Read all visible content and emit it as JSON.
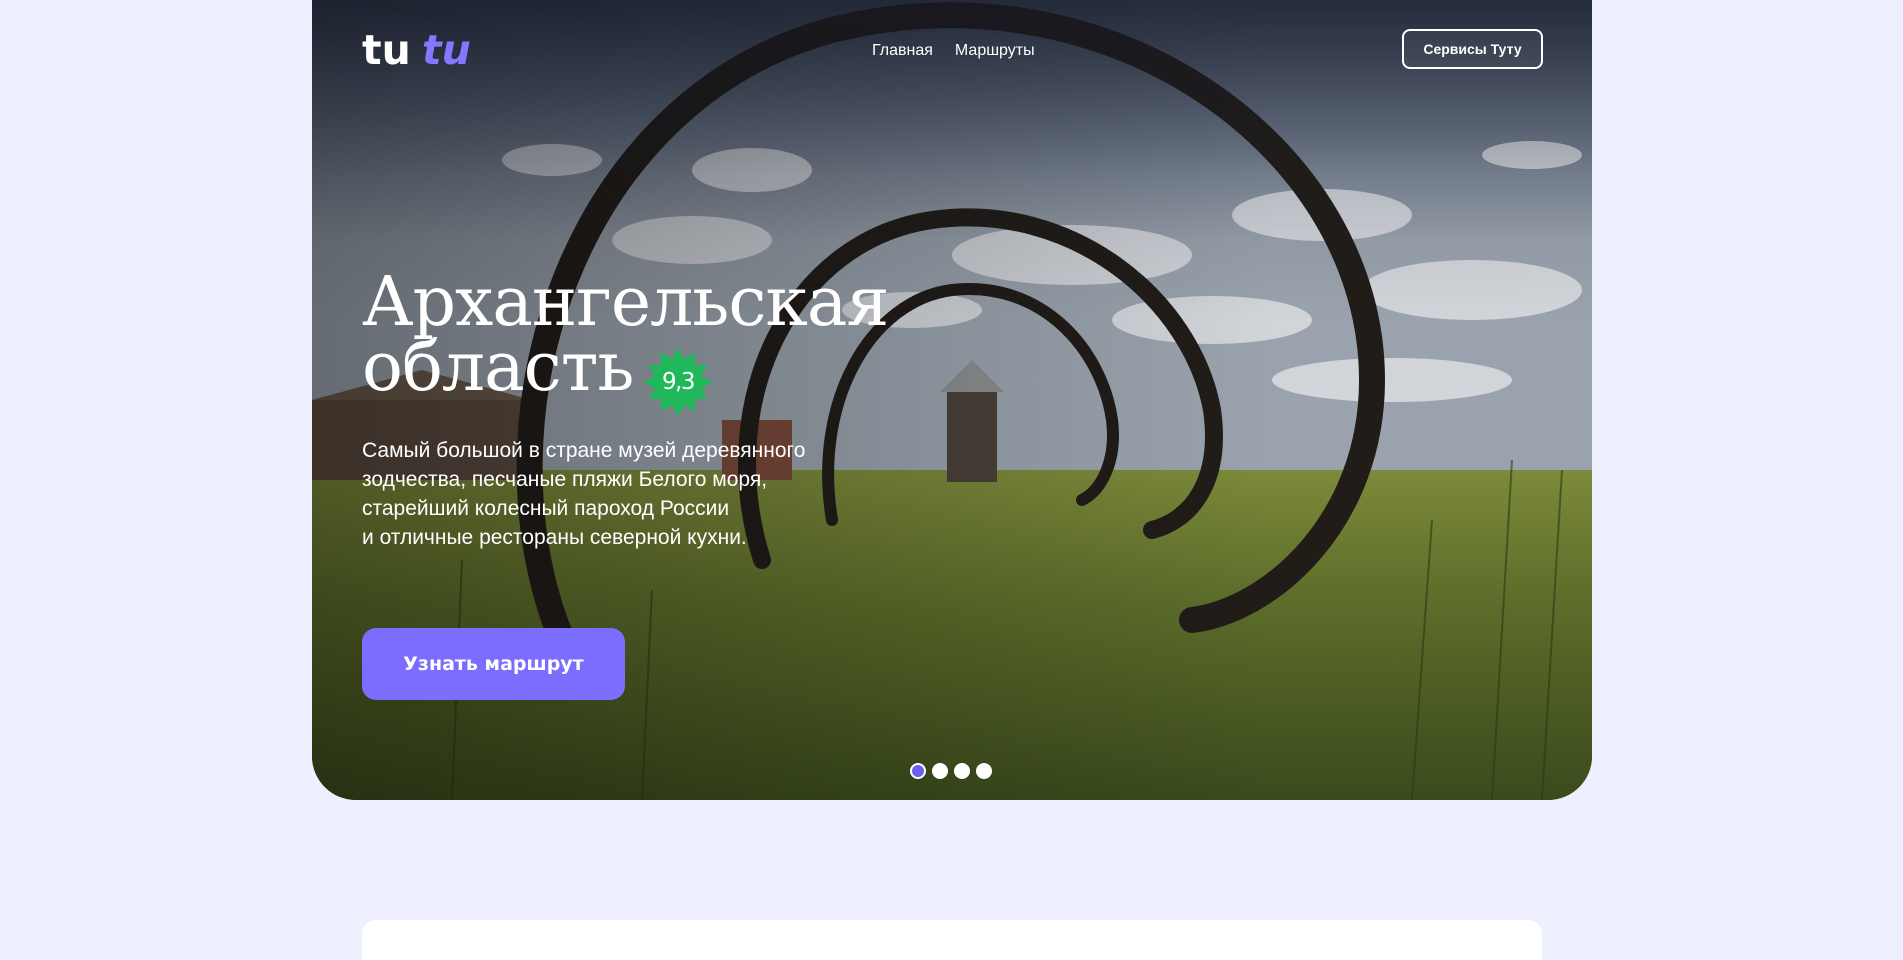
{
  "brand": {
    "logo_part1": "tu",
    "logo_part2": "tu",
    "logo_color_white": "#ffffff",
    "logo_color_accent": "#8577ff"
  },
  "nav": {
    "items": [
      {
        "label": "Главная"
      },
      {
        "label": "Маршруты"
      }
    ]
  },
  "header": {
    "services_label": "Сервисы Туту"
  },
  "hero": {
    "title_line1": "Архангельская",
    "title_line2": "область",
    "rating": "9,3",
    "rating_color": "#1fb85a",
    "description_lines": [
      "Самый большой в стране музей деревянного",
      "зодчества, песчаные пляжи Белого моря,",
      "старейший колесный пароход России",
      "и отличные рестораны северной кухни."
    ],
    "cta_label": "Узнать маршрут",
    "cta_color": "#7b6dfe",
    "slides_total": 4,
    "active_slide": 1
  },
  "colors": {
    "page_background": "#eeefff",
    "dot_active": "#6c5ff2"
  }
}
